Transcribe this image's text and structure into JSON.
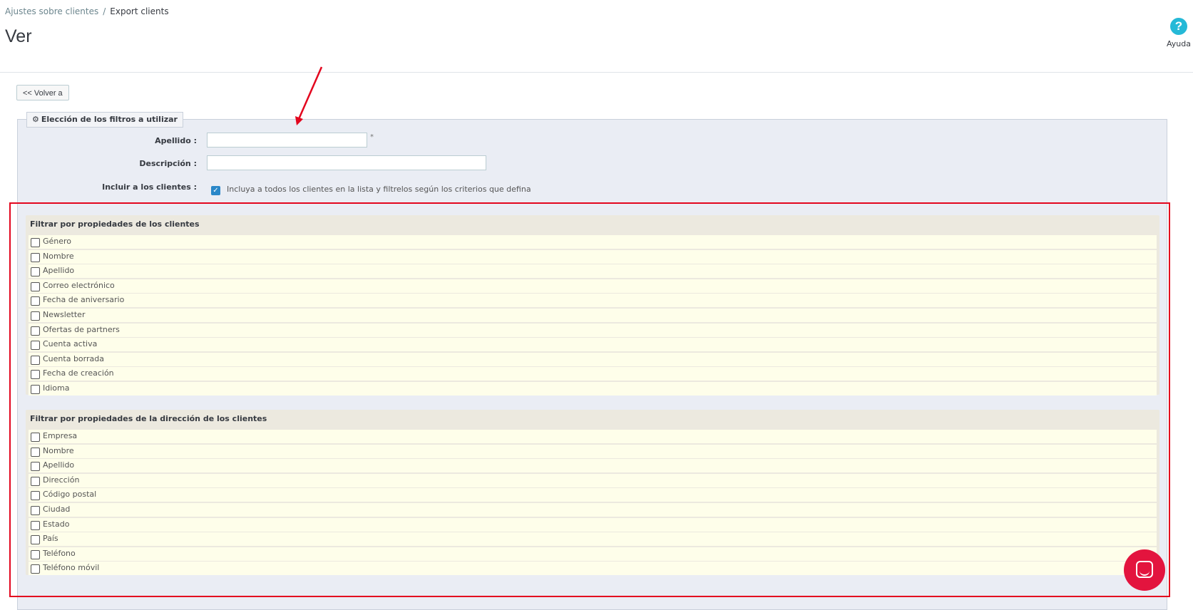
{
  "breadcrumb": {
    "parent": "Ajustes sobre clientes",
    "separator": "/",
    "current": "Export clients"
  },
  "page": {
    "title": "Ver"
  },
  "help": {
    "icon": "?",
    "label": "Ayuda"
  },
  "back_button": {
    "label": "<< Volver a"
  },
  "fieldset": {
    "icon": "gear-icon",
    "legend": "Elección de los filtros a utilizar"
  },
  "form": {
    "apellido_label": "Apellido :",
    "apellido_value": "",
    "required_mark": "*",
    "descripcion_label": "Descripción :",
    "descripcion_value": "",
    "incluir_label": "Incluir a los clientes :",
    "incluir_text": "Incluya a todos los clientes en la lista y filtrelos según los criterios que defina",
    "incluir_checked": true
  },
  "groups": [
    {
      "title": "Filtrar por propiedades de los clientes",
      "items": [
        "Género",
        "Nombre",
        "Apellido",
        "Correo electrónico",
        "Fecha de aniversario",
        "Newsletter",
        "Ofertas de partners",
        "Cuenta activa",
        "Cuenta borrada",
        "Fecha de creación",
        "Idioma"
      ]
    },
    {
      "title": "Filtrar por propiedades de la dirección de los clientes",
      "items": [
        "Empresa",
        "Nombre",
        "Apellido",
        "Dirección",
        "Código postal",
        "Ciudad",
        "Estado",
        "País",
        "Teléfono",
        "Teléfono móvil"
      ]
    }
  ],
  "colors": {
    "accent": "#25b9d7",
    "annotation": "#e3061e",
    "chat": "#e3143e"
  }
}
